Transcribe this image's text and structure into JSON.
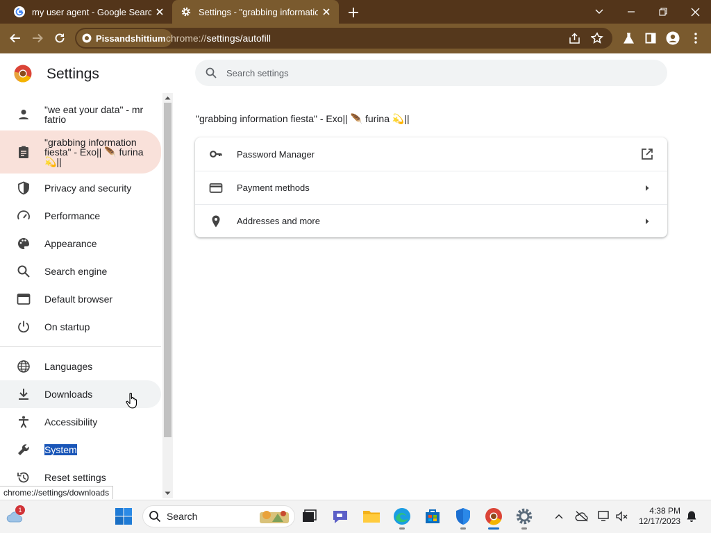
{
  "browser": {
    "tabs": [
      {
        "title": "my user agent - Google Search"
      },
      {
        "title": "Settings - \"grabbing information fiesta\" - Exo"
      }
    ],
    "profile_chip": "Pissandshittium",
    "url_scheme": "chrome://",
    "url_path": "settings/autofill",
    "status_url": "chrome://settings/downloads"
  },
  "settings": {
    "title": "Settings",
    "search_placeholder": "Search settings",
    "sidebar": [
      {
        "label": "\"we eat your data\" - mr fatrio",
        "icon": "person-icon"
      },
      {
        "label": "\"grabbing information fiesta\" - Exo|| 🪶 furina 💫||",
        "icon": "clipboard-icon"
      },
      {
        "label": "Privacy and security",
        "icon": "shield-icon"
      },
      {
        "label": "Performance",
        "icon": "speedometer-icon"
      },
      {
        "label": "Appearance",
        "icon": "palette-icon"
      },
      {
        "label": "Search engine",
        "icon": "search-icon"
      },
      {
        "label": "Default browser",
        "icon": "browser-window-icon"
      },
      {
        "label": "On startup",
        "icon": "power-icon"
      },
      {
        "label": "Languages",
        "icon": "globe-icon"
      },
      {
        "label": "Downloads",
        "icon": "download-icon"
      },
      {
        "label": "Accessibility",
        "icon": "accessibility-icon"
      },
      {
        "label": "System",
        "icon": "wrench-icon"
      },
      {
        "label": "Reset settings",
        "icon": "history-icon"
      }
    ],
    "section_title": "\"grabbing information fiesta\" - Exo|| 🪶 furina 💫||",
    "autofill_rows": [
      {
        "label": "Password Manager",
        "icon": "key-icon",
        "end": "open-external-icon"
      },
      {
        "label": "Payment methods",
        "icon": "credit-card-icon",
        "end": "arrow-right-icon"
      },
      {
        "label": "Addresses and more",
        "icon": "location-pin-icon",
        "end": "arrow-right-icon"
      }
    ]
  },
  "taskbar": {
    "search_label": "Search",
    "time": "4:38 PM",
    "date": "12/17/2023",
    "weather_badge": "1"
  },
  "colors": {
    "tab_strip": "#53351a",
    "toolbar": "#7a5a2e",
    "selected_nav": "#f9e1da",
    "selection_highlight": "#1a56b8"
  }
}
